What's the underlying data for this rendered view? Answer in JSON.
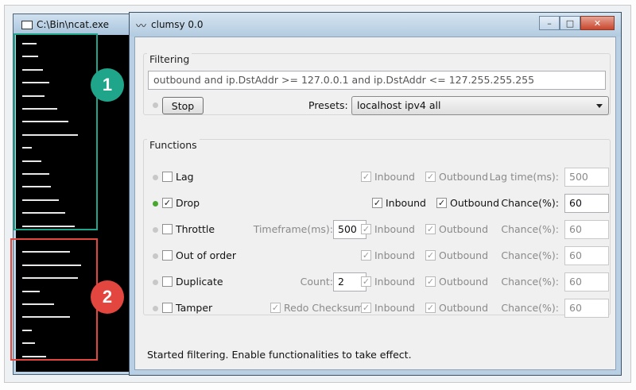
{
  "ncat": {
    "title": "C:\\Bin\\ncat.exe",
    "dash_lengths": [
      18,
      20,
      26,
      34,
      28,
      44,
      58,
      70,
      12,
      24,
      34,
      36,
      46,
      54,
      66,
      48,
      60,
      74,
      70,
      22,
      40,
      60,
      12,
      16,
      30
    ]
  },
  "annotations": {
    "box1": {
      "label": "1",
      "color": "#1fa58a"
    },
    "box2": {
      "label": "2",
      "color": "#e2463f"
    }
  },
  "clumsy": {
    "title": "clumsy 0.0",
    "window_buttons": {
      "minimize": "–",
      "maximize": "□",
      "close": "✕"
    },
    "filtering": {
      "group_label": "Filtering",
      "filter_text": "outbound and ip.DstAddr >= 127.0.0.1 and ip.DstAddr <= 127.255.255.255",
      "stop_label": "Stop",
      "presets_label": "Presets:",
      "preset_value": "localhost ipv4 all"
    },
    "functions": {
      "group_label": "Functions",
      "rows": [
        {
          "name": "Lag",
          "enabled": false,
          "extra_label": "",
          "extra_value": "",
          "inbound": true,
          "outbound": true,
          "active_in_out": false,
          "param_label": "Lag time(ms):",
          "param_value": "500"
        },
        {
          "name": "Drop",
          "enabled": true,
          "extra_label": "",
          "extra_value": "",
          "inbound": true,
          "outbound": true,
          "active_in_out": true,
          "param_label": "Chance(%):",
          "param_value": "60"
        },
        {
          "name": "Throttle",
          "enabled": false,
          "extra_label": "Timeframe(ms):",
          "extra_value": "500",
          "inbound": true,
          "outbound": true,
          "active_in_out": false,
          "param_label": "Chance(%):",
          "param_value": "60"
        },
        {
          "name": "Out of order",
          "enabled": false,
          "extra_label": "",
          "extra_value": "",
          "inbound": true,
          "outbound": true,
          "active_in_out": false,
          "param_label": "Chance(%):",
          "param_value": "60"
        },
        {
          "name": "Duplicate",
          "enabled": false,
          "extra_label": "Count:",
          "extra_value": "2",
          "inbound": true,
          "outbound": true,
          "active_in_out": false,
          "param_label": "Chance(%):",
          "param_value": "60"
        },
        {
          "name": "Tamper",
          "enabled": false,
          "extra_label": "Redo Checksum",
          "extra_value": "",
          "inbound": true,
          "outbound": true,
          "active_in_out": false,
          "param_label": "Chance(%):",
          "param_value": "60"
        }
      ],
      "inbound_label": "Inbound",
      "outbound_label": "Outbound"
    },
    "status": "Started filtering. Enable functionalities to take effect."
  },
  "colors": {
    "led_on": "#47a72f",
    "led_off": "#c8c8c8",
    "close_button": "#c9462c"
  }
}
